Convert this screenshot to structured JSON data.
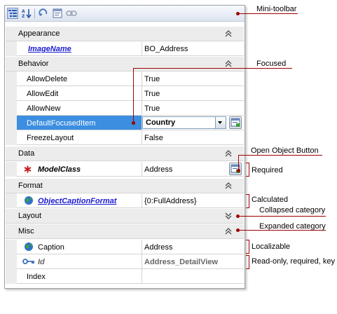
{
  "toolbar": {
    "buttons": [
      {
        "icon": "categorized-view-icon",
        "pressed": true
      },
      {
        "icon": "alphabetical-sort-icon",
        "pressed": false
      },
      {
        "icon": "reset-icon",
        "pressed": false
      },
      {
        "icon": "show-description-icon",
        "pressed": false
      },
      {
        "icon": "link-icon",
        "pressed": false
      }
    ]
  },
  "categories": {
    "appearance": "Appearance",
    "behavior": "Behavior",
    "data": "Data",
    "format": "Format",
    "layout": "Layout",
    "misc": "Misc"
  },
  "properties": {
    "image_name": {
      "name": "ImageName",
      "value": "BO_Address"
    },
    "allow_delete": {
      "name": "AllowDelete",
      "value": "True"
    },
    "allow_edit": {
      "name": "AllowEdit",
      "value": "True"
    },
    "allow_new": {
      "name": "AllowNew",
      "value": "True"
    },
    "default_focused_item": {
      "name": "DefaultFocusedItem",
      "value": "Country"
    },
    "freeze_layout": {
      "name": "FreezeLayout",
      "value": "False"
    },
    "model_class": {
      "name": "ModelClass",
      "value": "Address"
    },
    "object_caption_format": {
      "name": "ObjectCaptionFormat",
      "value": "{0:FullAddress}"
    },
    "caption": {
      "name": "Caption",
      "value": "Address"
    },
    "id": {
      "name": "Id",
      "value": "Address_DetailView"
    },
    "index": {
      "name": "Index",
      "value": ""
    }
  },
  "annotations": {
    "mini_toolbar": "Mini-toolbar",
    "focused": "Focused",
    "open_object_button": "Open Object Button",
    "required": "Required",
    "calculated": "Calculated",
    "collapsed_category": "Collapsed category",
    "expanded_category": "Expanded category",
    "localizable": "Localizable",
    "read_only": "Read-only, required, key"
  },
  "colors": {
    "annotation": "#a00000",
    "selection": "#3b8ee0",
    "link": "#1b1bd0"
  }
}
